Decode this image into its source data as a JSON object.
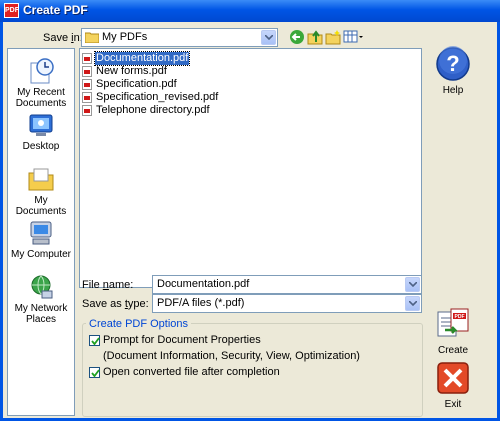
{
  "window": {
    "title": "Create PDF",
    "app_icon": "pdf-app-icon"
  },
  "save_in": {
    "label_pre": "Save ",
    "label_key": "i",
    "label_post": "n:",
    "value": "My PDFs",
    "icon": "folder-icon"
  },
  "toolbar": {
    "icons": [
      "back-icon",
      "up-folder-icon",
      "new-folder-icon",
      "view-menu-icon"
    ]
  },
  "places": [
    {
      "label": "My Recent Documents",
      "icon": "recent-documents-icon"
    },
    {
      "label": "Desktop",
      "icon": "desktop-icon"
    },
    {
      "label": "My Documents",
      "icon": "my-documents-icon"
    },
    {
      "label": "My Computer",
      "icon": "my-computer-icon"
    },
    {
      "label": "My Network Places",
      "icon": "network-places-icon"
    }
  ],
  "files": [
    {
      "name": "Documentation.pdf",
      "selected": true
    },
    {
      "name": "New forms.pdf",
      "selected": false
    },
    {
      "name": "Specification.pdf",
      "selected": false
    },
    {
      "name": "Specification_revised.pdf",
      "selected": false
    },
    {
      "name": "Telephone directory.pdf",
      "selected": false
    }
  ],
  "file_name": {
    "label_pre": "File ",
    "label_key": "n",
    "label_post": "ame:",
    "value": "Documentation.pdf"
  },
  "save_as_type": {
    "label_pre": "Save as ",
    "label_key": "t",
    "label_post": "ype:",
    "value": "PDF/A files (*.pdf)"
  },
  "options": {
    "title": "Create PDF Options",
    "prompt_label": "Prompt for Document Properties",
    "prompt_sub": "(Document Information, Security, View, Optimization)",
    "prompt_checked": true,
    "open_label": "Open converted file after completion",
    "open_checked": true
  },
  "buttons": {
    "help": "Help",
    "create": "Create",
    "exit": "Exit"
  }
}
